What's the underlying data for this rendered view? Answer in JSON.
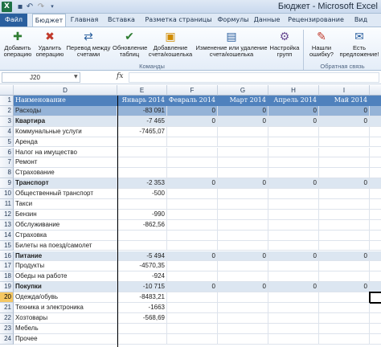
{
  "titlebar": {
    "app_icon": "X",
    "title": "Бюджет - Microsoft Excel",
    "qat": [
      "save-icon",
      "undo-icon",
      "redo-icon",
      "customize-icon"
    ]
  },
  "ribbon_tabs": [
    "Файл",
    "Бюджет",
    "Главная",
    "Вставка",
    "Разметка страницы",
    "Формулы",
    "Данные",
    "Рецензирование",
    "Вид"
  ],
  "ribbon": {
    "buttons": [
      {
        "id": "add",
        "label": "Добавить операцию",
        "icon": "add-operation-icon",
        "glyph": "✚",
        "color": "#2f7d32"
      },
      {
        "id": "delete",
        "label": "Удалить операцию",
        "icon": "delete-operation-icon",
        "glyph": "✖",
        "color": "#c0392b"
      },
      {
        "id": "transfer",
        "label": "Перевод между счетами",
        "icon": "transfer-icon",
        "glyph": "⇄",
        "color": "#2a5f9e"
      },
      {
        "id": "refresh",
        "label": "Обновление таблиц",
        "icon": "refresh-icon",
        "glyph": "✔",
        "color": "#2f7d32"
      },
      {
        "id": "add_account",
        "label": "Добавление счета/кошелька",
        "icon": "add-wallet-icon",
        "glyph": "▣",
        "color": "#d08b00"
      },
      {
        "id": "edit_account",
        "label": "Изменение или удаление счета/кошелька",
        "icon": "edit-wallet-icon",
        "glyph": "▤",
        "color": "#2a5f9e"
      },
      {
        "id": "group_settings",
        "label": "Настройка групп",
        "icon": "group-settings-icon",
        "glyph": "⚙",
        "color": "#6a4c93"
      },
      {
        "id": "found_error",
        "label": "Нашли ошибку?",
        "icon": "bug-report-icon",
        "glyph": "✎",
        "color": "#c0392b"
      },
      {
        "id": "suggest",
        "label": "Есть предложение!",
        "icon": "suggestion-icon",
        "glyph": "✉",
        "color": "#2a5f9e"
      }
    ],
    "group_commands": "Команды",
    "group_feedback": "Обратная связь"
  },
  "formula_bar": {
    "name_box": "J20",
    "fx": "fx",
    "value": ""
  },
  "columns": [
    "D",
    "E",
    "F",
    "G",
    "H",
    "I",
    "J"
  ],
  "rows": [
    {
      "n": "1",
      "type": "hdr",
      "cells": [
        "Наименование",
        "Январь 2014",
        "Февраль 2014",
        "Март 2014",
        "Апрель 2014",
        "Май 2014",
        "Июн"
      ]
    },
    {
      "n": "2",
      "type": "exp",
      "cells": [
        "Расходы",
        "-83 091",
        "0",
        "0",
        "0",
        "0",
        ""
      ]
    },
    {
      "n": "3",
      "type": "cat",
      "bold": true,
      "cells": [
        "Квартира",
        "-7 465",
        "0",
        "0",
        "0",
        "0",
        ""
      ]
    },
    {
      "n": "4",
      "type": "item",
      "cells": [
        "Коммунальные услуги",
        "-7465,07",
        "",
        "",
        "",
        "",
        ""
      ]
    },
    {
      "n": "5",
      "type": "item",
      "cells": [
        "Аренда",
        "",
        "",
        "",
        "",
        "",
        ""
      ]
    },
    {
      "n": "6",
      "type": "item",
      "cells": [
        "Налог на имущество",
        "",
        "",
        "",
        "",
        "",
        ""
      ]
    },
    {
      "n": "7",
      "type": "item",
      "cells": [
        "Ремонт",
        "",
        "",
        "",
        "",
        "",
        ""
      ]
    },
    {
      "n": "8",
      "type": "item",
      "cells": [
        "Страхование",
        "",
        "",
        "",
        "",
        "",
        ""
      ]
    },
    {
      "n": "9",
      "type": "cat",
      "bold": true,
      "cells": [
        "Транспорт",
        "-2 353",
        "0",
        "0",
        "0",
        "0",
        ""
      ]
    },
    {
      "n": "10",
      "type": "item",
      "cells": [
        "Общественный транспорт",
        "-500",
        "",
        "",
        "",
        "",
        ""
      ]
    },
    {
      "n": "11",
      "type": "item",
      "cells": [
        "Такси",
        "",
        "",
        "",
        "",
        "",
        ""
      ]
    },
    {
      "n": "12",
      "type": "item",
      "cells": [
        "Бензин",
        "-990",
        "",
        "",
        "",
        "",
        ""
      ]
    },
    {
      "n": "13",
      "type": "item",
      "cells": [
        "Обслуживание",
        "-862,56",
        "",
        "",
        "",
        "",
        ""
      ]
    },
    {
      "n": "14",
      "type": "item",
      "cells": [
        "Страховка",
        "",
        "",
        "",
        "",
        "",
        ""
      ]
    },
    {
      "n": "15",
      "type": "item",
      "cells": [
        "Билеты на поезд/самолет",
        "",
        "",
        "",
        "",
        "",
        ""
      ]
    },
    {
      "n": "16",
      "type": "cat",
      "bold": true,
      "cells": [
        "Питание",
        "-5 494",
        "0",
        "0",
        "0",
        "0",
        ""
      ]
    },
    {
      "n": "17",
      "type": "item",
      "cells": [
        "Продукты",
        "-4570,35",
        "",
        "",
        "",
        "",
        ""
      ]
    },
    {
      "n": "18",
      "type": "item",
      "cells": [
        "Обеды на работе",
        "-924",
        "",
        "",
        "",
        "",
        ""
      ]
    },
    {
      "n": "19",
      "type": "cat",
      "bold": true,
      "cells": [
        "Покупки",
        "-10 715",
        "0",
        "0",
        "0",
        "0",
        ""
      ]
    },
    {
      "n": "20",
      "type": "item",
      "selected": true,
      "cells": [
        "Одежда/обувь",
        "-8483,21",
        "",
        "",
        "",
        "",
        ""
      ]
    },
    {
      "n": "21",
      "type": "item",
      "cells": [
        "Техника и электроника",
        "-1663",
        "",
        "",
        "",
        "",
        ""
      ]
    },
    {
      "n": "22",
      "type": "item",
      "cells": [
        "Хозтовары",
        "-568,69",
        "",
        "",
        "",
        "",
        ""
      ]
    },
    {
      "n": "23",
      "type": "item",
      "cells": [
        "Мебель",
        "",
        "",
        "",
        "",
        "",
        ""
      ]
    },
    {
      "n": "24",
      "type": "item",
      "cells": [
        "Прочее",
        "",
        "",
        "",
        "",
        "",
        ""
      ]
    }
  ]
}
